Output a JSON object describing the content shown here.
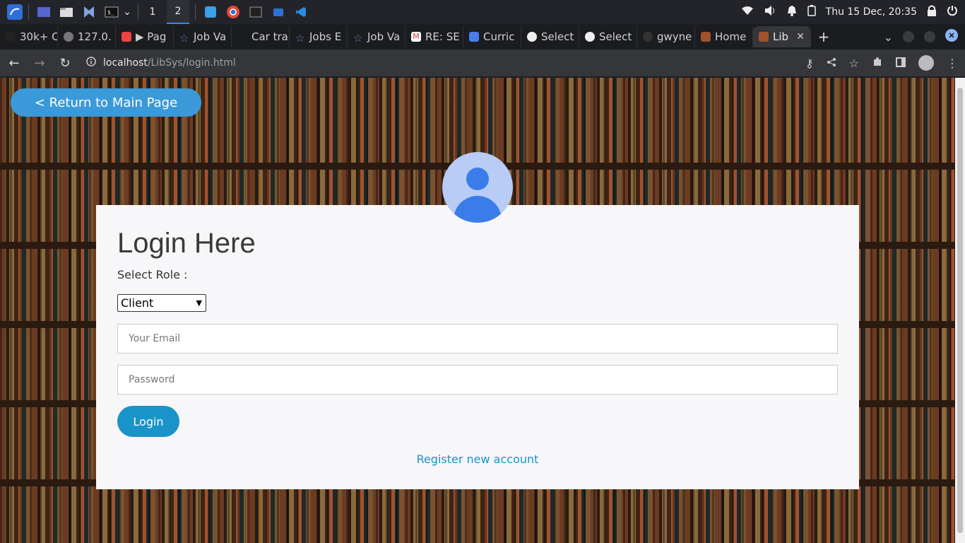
{
  "taskbar": {
    "workspaces": [
      "1",
      "2"
    ],
    "active_workspace": "2",
    "clock": "Thu 15 Dec, 20:35"
  },
  "tabs": [
    {
      "label": "30k+ C",
      "icon": "github-cat-icon"
    },
    {
      "label": "127.0.",
      "icon": "globe-icon"
    },
    {
      "label": "▶ Pag",
      "icon": "figma-icon"
    },
    {
      "label": "Job Va",
      "icon": "star-icon"
    },
    {
      "label": "Car tra",
      "icon": "blank-icon"
    },
    {
      "label": "Jobs E",
      "icon": "star-icon"
    },
    {
      "label": "Job Va",
      "icon": "star-icon"
    },
    {
      "label": "RE: SE",
      "icon": "gmail-icon"
    },
    {
      "label": "Curric",
      "icon": "docs-icon"
    },
    {
      "label": "Select",
      "icon": "globe-icon"
    },
    {
      "label": "Select",
      "icon": "globe-icon"
    },
    {
      "label": "gwyne",
      "icon": "github-icon"
    },
    {
      "label": "Home",
      "icon": "site-icon"
    },
    {
      "label": "Lib",
      "icon": "site-icon",
      "active": true
    }
  ],
  "omnibox": {
    "host": "localhost",
    "path": "/LibSys/login.html"
  },
  "page": {
    "return_label": "< Return to Main Page",
    "title": "Login Here",
    "role_label": "Select Role :",
    "role_selected": "Client",
    "email_placeholder": "Your Email",
    "password_placeholder": "Password",
    "login_label": "Login",
    "register_label": "Register new account"
  },
  "colors": {
    "accent": "#1a93c9",
    "return_button": "#3a9ad9",
    "avatar_bg": "#b8ccf5",
    "avatar_fg": "#3b7de8"
  }
}
